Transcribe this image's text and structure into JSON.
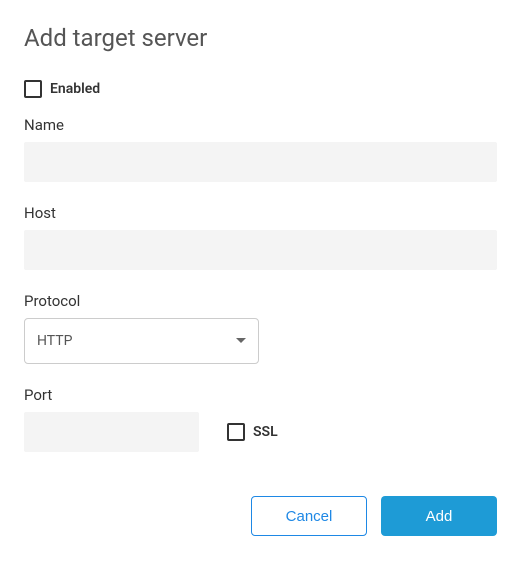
{
  "dialog": {
    "title": "Add target server"
  },
  "enabled": {
    "label": "Enabled",
    "checked": false
  },
  "name": {
    "label": "Name",
    "value": ""
  },
  "host": {
    "label": "Host",
    "value": ""
  },
  "protocol": {
    "label": "Protocol",
    "selected": "HTTP"
  },
  "port": {
    "label": "Port",
    "value": ""
  },
  "ssl": {
    "label": "SSL",
    "checked": false
  },
  "buttons": {
    "cancel": "Cancel",
    "add": "Add"
  }
}
